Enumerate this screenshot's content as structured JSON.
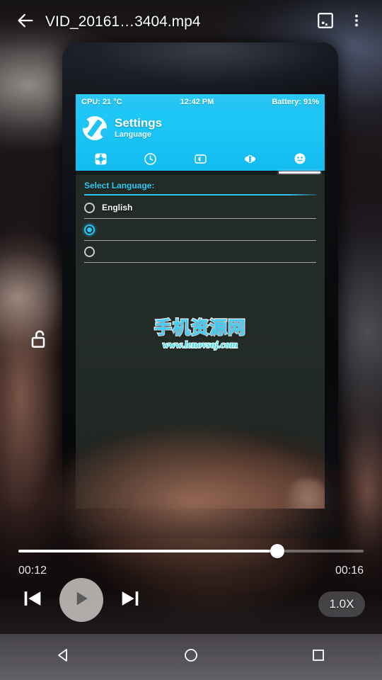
{
  "player": {
    "title": "VID_20161…3404.mp4",
    "back_icon": "back-arrow-icon",
    "capture_icon": "screen-capture-icon",
    "overflow_icon": "more-options-icon",
    "lock_icon": "unlocked-padlock-icon",
    "current_time": "00:12",
    "total_time": "00:16",
    "progress_percent": 75,
    "speed_label": "1.0X",
    "prev_icon": "skip-previous-icon",
    "play_icon": "play-icon",
    "next_icon": "skip-next-icon"
  },
  "video_frame": {
    "app_status": {
      "cpu": "CPU: 21 °C",
      "clock": "12:42 PM",
      "battery": "Battery: 91%"
    },
    "app_header": {
      "title": "Settings",
      "subtitle": "Language",
      "logo_icon": "settings-wrench-logo-icon"
    },
    "tabs": [
      {
        "icon": "gear-icon",
        "active": false
      },
      {
        "icon": "clock-icon",
        "active": false
      },
      {
        "icon": "brightness-icon",
        "active": false
      },
      {
        "icon": "battery-icon",
        "active": false
      },
      {
        "icon": "language-face-icon",
        "active": true
      }
    ],
    "section_label": "Select Language:",
    "languages": [
      {
        "label": "English",
        "selected": false
      },
      {
        "label": "",
        "selected": true
      },
      {
        "label": "",
        "selected": false
      }
    ],
    "watermark": {
      "name": "手机资源网",
      "url": "www.lenovsoj.com"
    }
  },
  "system_nav": {
    "back_icon": "nav-back-triangle-icon",
    "home_icon": "nav-home-circle-icon",
    "recents_icon": "nav-recents-square-icon"
  },
  "colors": {
    "app_accent": "#20c4f2",
    "radio_selected": "#23c6f5",
    "watermark_cn": "#3dd0fb",
    "watermark_url": "#33e0e8"
  }
}
